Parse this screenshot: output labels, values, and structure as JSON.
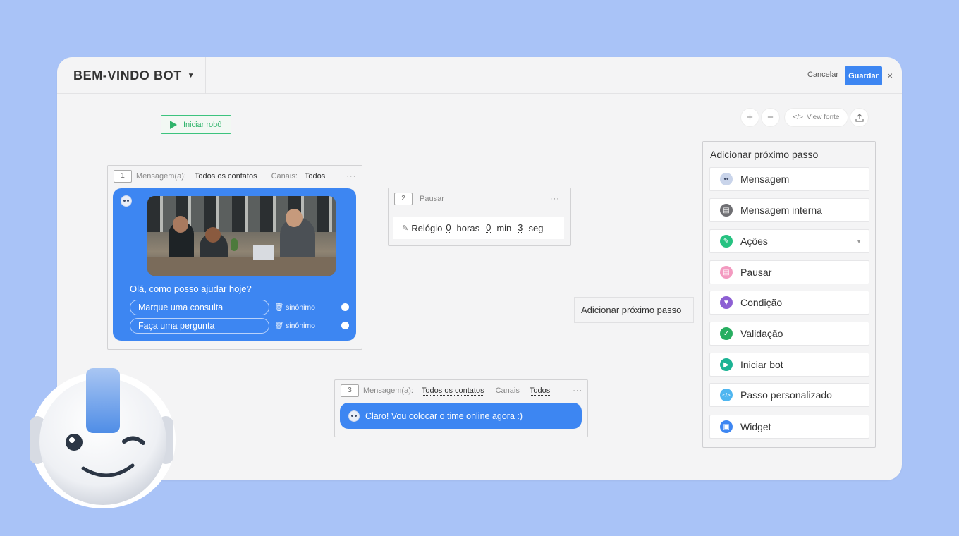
{
  "header": {
    "title": "BEM-VINDO BOT",
    "cancel_label": "Cancelar",
    "save_label": "Guardar",
    "close_glyph": "×"
  },
  "toolbar": {
    "zoom_in": "+",
    "zoom_out": "−",
    "view_source_label": "View fonte",
    "code_glyph": "</>"
  },
  "start_button": {
    "label": "Iniciar robô"
  },
  "step1": {
    "number": "1",
    "type_label": "Mensagem(a):",
    "audience": "Todos os contatos",
    "channels_label": "Canais:",
    "channels": "Todos",
    "menu": "···",
    "message": "Olá, como posso ajudar hoje?",
    "options": [
      {
        "label": "Marque uma consulta",
        "synonym": "sinônimo"
      },
      {
        "label": "Faça uma pergunta",
        "synonym": "sinônimo"
      }
    ]
  },
  "step2": {
    "number": "2",
    "title": "Pausar",
    "menu": "···",
    "clock_label": "Relógio",
    "hours": "0",
    "hours_label": "horas",
    "minutes": "0",
    "minutes_label": "min",
    "seconds": "3",
    "seconds_label": "seg"
  },
  "step3": {
    "number": "3",
    "type_label": "Mensagem(a):",
    "audience": "Todos os contatos",
    "channels_label": "Canais",
    "channels": "Todos",
    "menu": "···",
    "message": "Claro! Vou colocar o time online agora :)"
  },
  "add_next_floating": {
    "label": "Adicionar próximo passo"
  },
  "add_next_panel": {
    "title": "Adicionar próximo passo",
    "items": [
      {
        "label": "Mensagem",
        "icon": "bot-icon",
        "color": "#c9d4ea"
      },
      {
        "label": "Mensagem interna",
        "icon": "note-icon",
        "color": "#6f6f73"
      },
      {
        "label": "Ações",
        "icon": "pencil-icon",
        "color": "#26c281"
      },
      {
        "label": "Pausar",
        "icon": "pause-icon",
        "color": "#f39ac0"
      },
      {
        "label": "Condição",
        "icon": "filter-icon",
        "color": "#8d5fd3"
      },
      {
        "label": "Validação",
        "icon": "check-icon",
        "color": "#27ae60"
      },
      {
        "label": "Iniciar bot",
        "icon": "play-icon",
        "color": "#1bb394"
      },
      {
        "label": "Passo personalizado",
        "icon": "code-icon",
        "color": "#4fb6f0"
      },
      {
        "label": "Widget",
        "icon": "widget-icon",
        "color": "#3d86f2"
      }
    ]
  },
  "colors": {
    "background": "#a9c3f7",
    "accent": "#3d86f2",
    "canvas": "#f4f4f5"
  }
}
